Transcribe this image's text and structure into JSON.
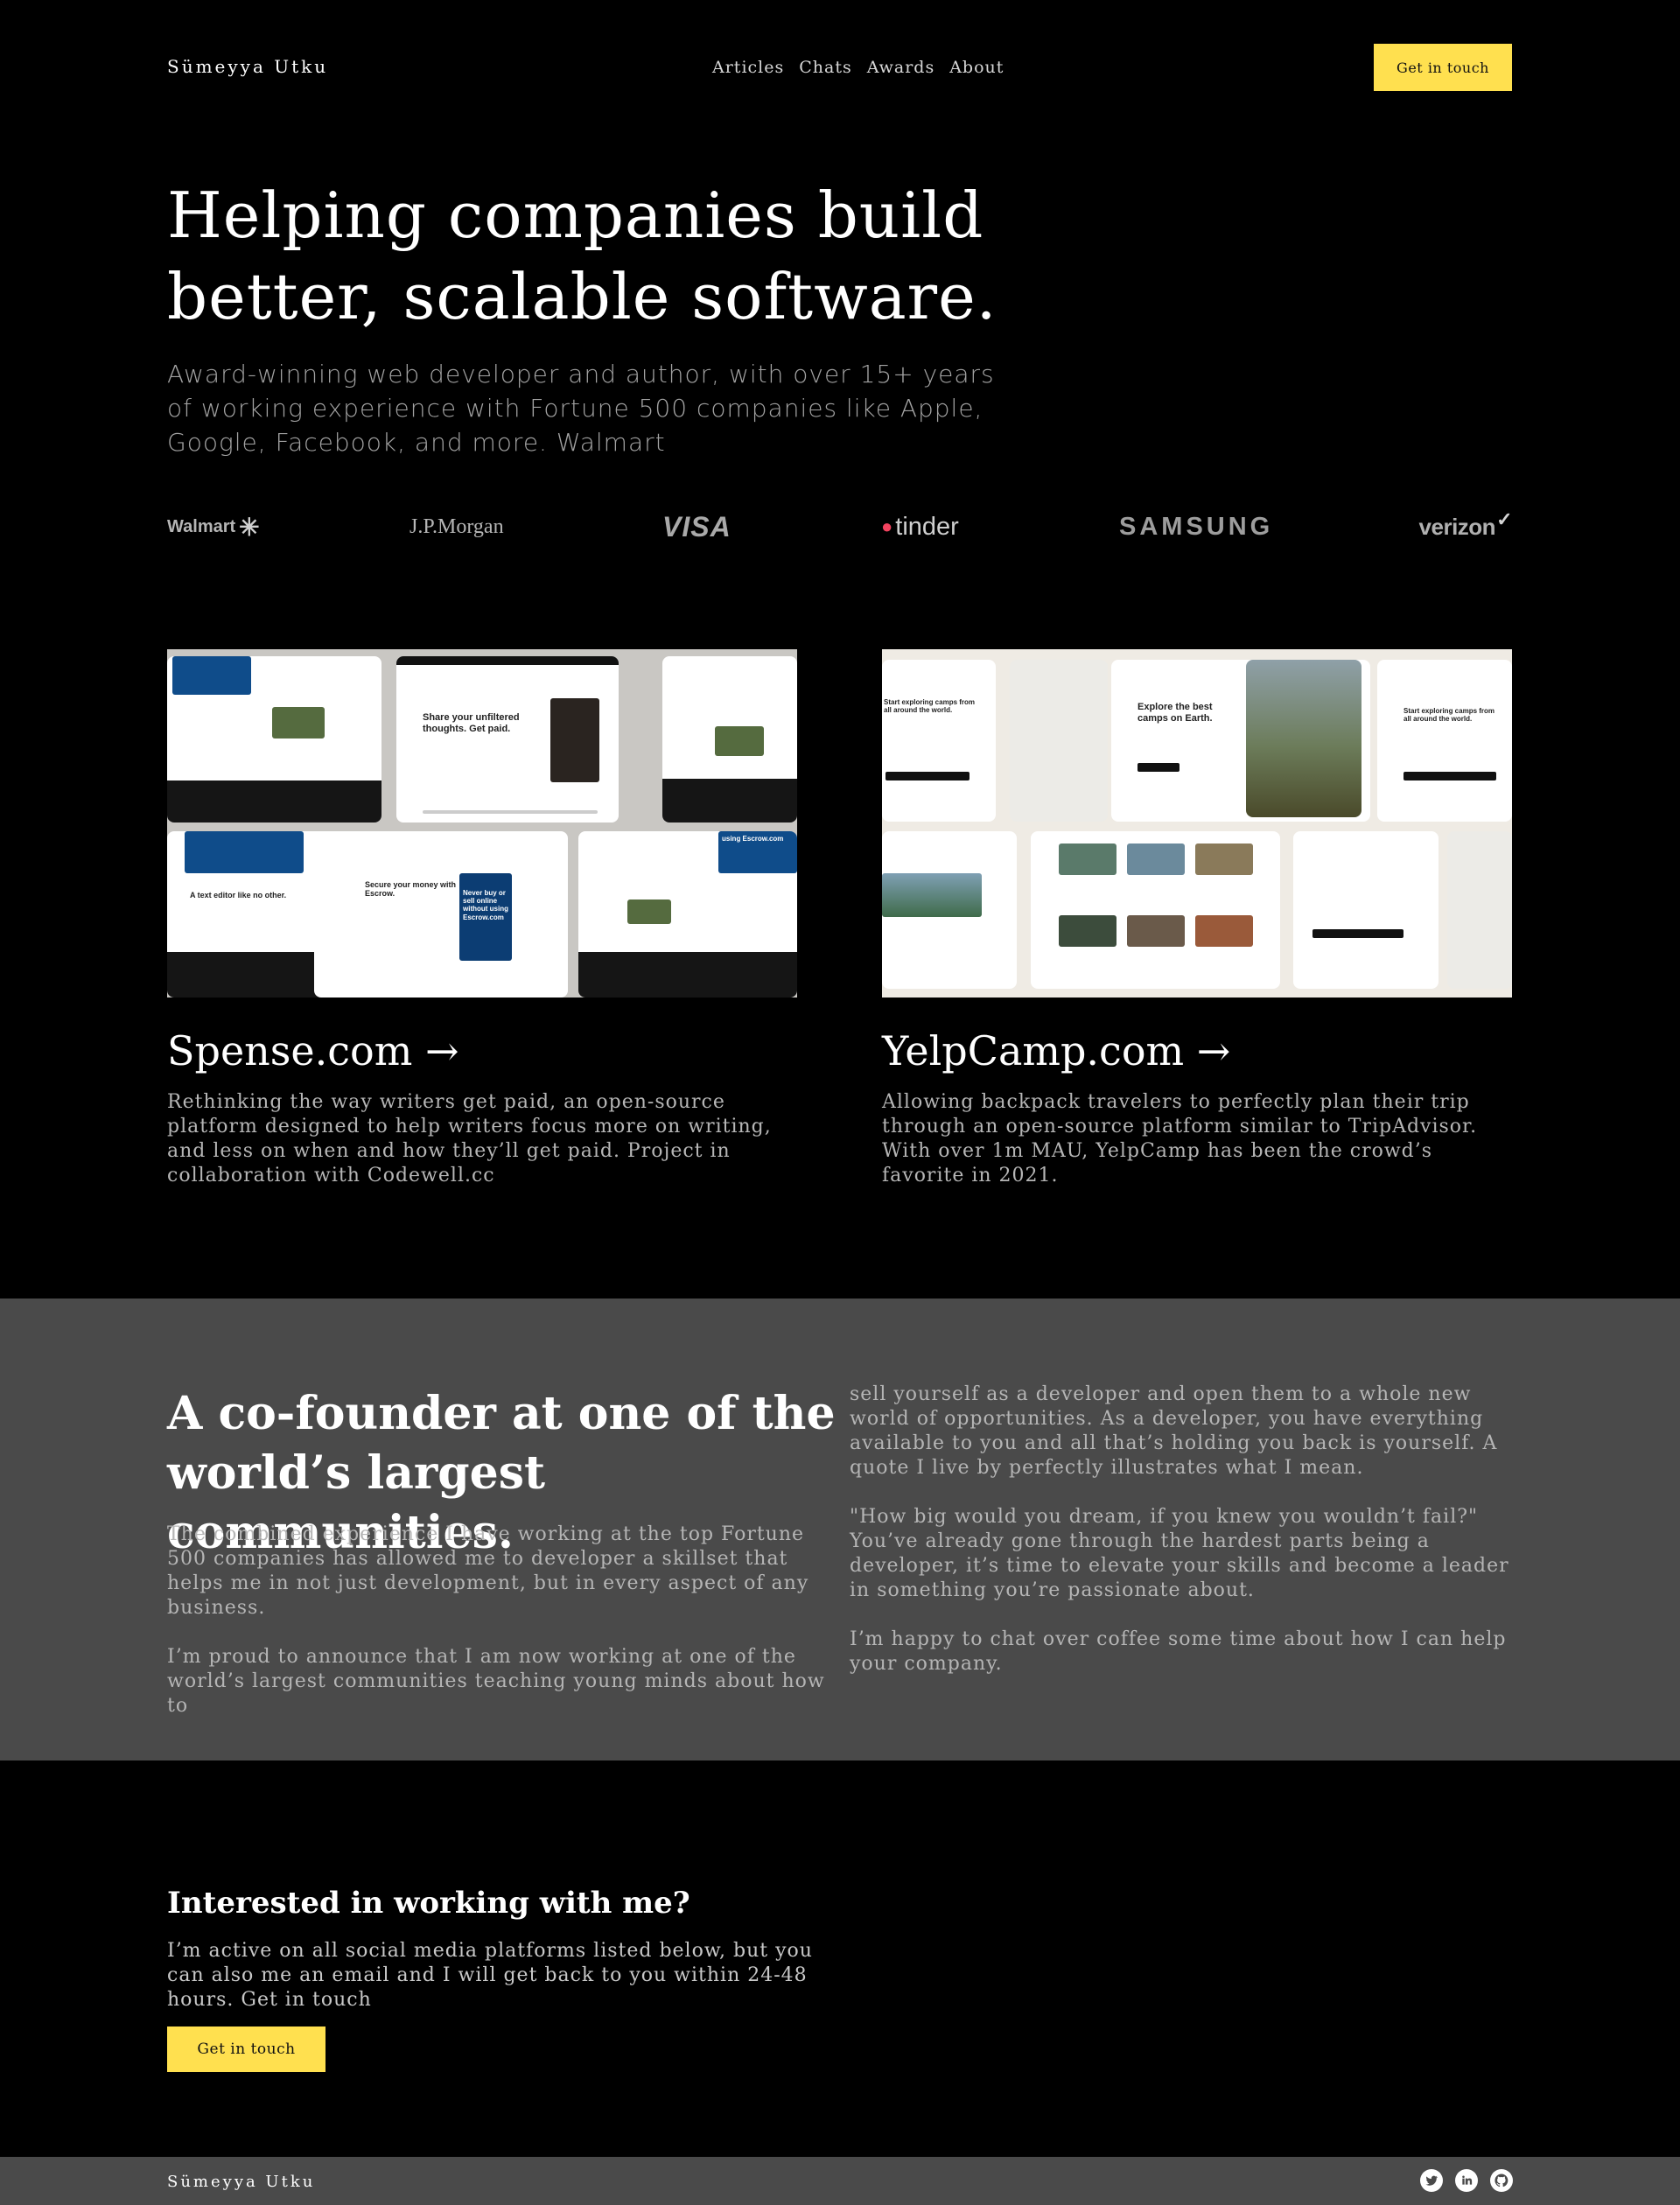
{
  "header": {
    "brand": "Sümeyya Utku",
    "nav": [
      "Articles",
      "Chats",
      "Awards",
      "About"
    ],
    "cta_label": "Get in touch"
  },
  "hero": {
    "title_line1": "Helping companies build",
    "title_line2": "better, scalable software.",
    "subtitle": "Award-winning web developer and author, with over 15+ years of working experience with Fortune 500 companies like Apple, Google, Facebook, and more. Walmart"
  },
  "logos": {
    "walmart": "Walmart",
    "walmart_spark": "✳",
    "jpmorgan": "J.P.Morgan",
    "visa": "VISA",
    "tinder": "tinder",
    "tinder_flame": "●",
    "samsung": "SAMSUNG",
    "verizon": "verizon",
    "verizon_check": "✓"
  },
  "projects": [
    {
      "title": "Spense.com →",
      "description": "Rethinking the way writers get paid, an open-source platform designed to help writers focus more on writing, and less on when and how they’ll get paid. Project in collaboration with Codewell.cc",
      "mock": {
        "headline": "Share your unfiltered thoughts. Get paid.",
        "secure": "Secure your money with Escrow.",
        "never": "Never buy or sell online without using Escrow.com",
        "editor": "A text editor like no other.",
        "escrow": "using Escrow.com"
      }
    },
    {
      "title": "YelpCamp.com →",
      "description": "Allowing backpack travelers to perfectly plan their trip through an open-source platform similar to TripAdvisor. With over 1m MAU, YelpCamp has been the crowd’s favorite in 2021.",
      "mock": {
        "explore": "Explore the best camps on Earth.",
        "start": "Start exploring camps from all around the world.",
        "start2": "Start exploring camps from all around the world."
      }
    }
  ],
  "about": {
    "title": "A co-founder at one of the world’s largest communities.",
    "left": [
      "The combined experience I have working at the top Fortune 500 companies has allowed me to developer a skillset that helps me in not just development, but in every aspect of any business.",
      "I’m proud to announce that I am now working at one of the world’s largest communities teaching young minds about how to"
    ],
    "right": [
      "sell yourself as a developer and open them to a whole new world of opportunities. As a developer, you have everything available to you and all that’s holding you back is yourself. A quote I live by perfectly illustrates what I mean.",
      "\"How big would you dream, if you knew you wouldn’t fail?\" You’ve already gone through the hardest parts being a developer, it’s time to elevate your skills and become a leader in something you’re passionate about.",
      "I’m happy to chat over coffee some time about how I can help your company."
    ]
  },
  "contact": {
    "title": "Interested in working with me?",
    "text": "I’m active on all social media platforms listed below, but you can also me an email and I will get back to you within 24-48 hours. Get in touch",
    "button_label": "Get in touch"
  },
  "footer": {
    "brand": "Sümeyya Utku",
    "social_icons": [
      "twitter-icon",
      "linkedin-icon",
      "github-icon"
    ]
  },
  "colors": {
    "background": "#000000",
    "section_grey": "#4a4a4a",
    "accent_yellow": "#ffe04f",
    "tinder_red": "#f3435f"
  }
}
